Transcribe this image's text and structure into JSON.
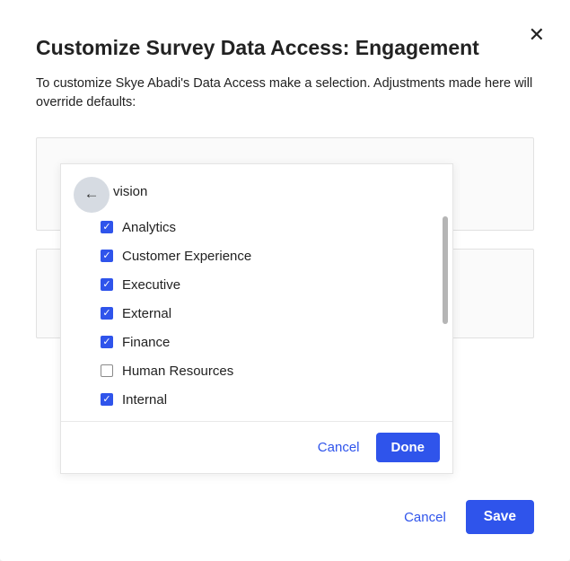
{
  "modal": {
    "title": "Customize Survey Data Access: Engagement",
    "description": "To customize Skye Abadi's Data Access make a selection. Adjustments made here will override defaults:"
  },
  "popover": {
    "category_label_visible": "vision",
    "items": [
      {
        "label": "Analytics",
        "checked": true
      },
      {
        "label": "Customer Experience",
        "checked": true
      },
      {
        "label": "Executive",
        "checked": true
      },
      {
        "label": "External",
        "checked": true
      },
      {
        "label": "Finance",
        "checked": true
      },
      {
        "label": "Human Resources",
        "checked": false
      },
      {
        "label": "Internal",
        "checked": true
      }
    ],
    "cancel_label": "Cancel",
    "done_label": "Done"
  },
  "footer": {
    "cancel_label": "Cancel",
    "save_label": "Save"
  }
}
